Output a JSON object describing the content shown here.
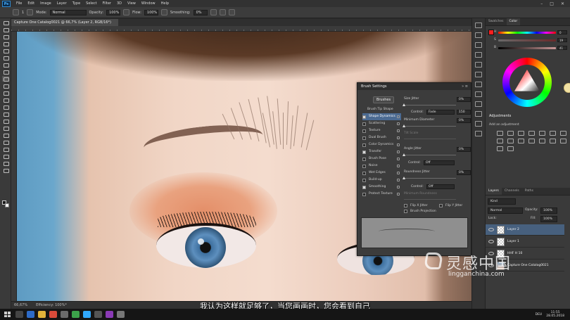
{
  "menu": {
    "logo": "Ps",
    "items": [
      "File",
      "Edit",
      "Image",
      "Layer",
      "Type",
      "Select",
      "Filter",
      "3D",
      "View",
      "Window",
      "Help"
    ]
  },
  "options": {
    "mode_label": "Mode:",
    "mode_value": "Normal",
    "opacity_label": "Opacity:",
    "opacity_value": "100%",
    "flow_label": "Flow:",
    "flow_value": "100%",
    "smoothing_label": "Smoothing:",
    "smoothing_value": "0%",
    "brush_size": "1"
  },
  "document": {
    "tab_title": "Capture One Catalog0021 @ 66,7% (Layer 2, RGB/16*)",
    "status_zoom": "66,67%",
    "status_info": "Efficiency: 100%*"
  },
  "color_panel": {
    "tabs": [
      "Swatches",
      "Color"
    ],
    "active_tab": "Color",
    "rows": [
      {
        "label": "H",
        "value": "0"
      },
      {
        "label": "S",
        "value": "19"
      },
      {
        "label": "B",
        "value": "41"
      }
    ]
  },
  "adjustments": {
    "title": "Adjustments",
    "subtitle": "Add an adjustment"
  },
  "layers": {
    "tabs": [
      "Layers",
      "Channels",
      "Paths"
    ],
    "filter_kind": "Kind",
    "blend_mode": "Normal",
    "opacity_label": "Opacity:",
    "opacity_value": "100%",
    "lock_label": "Lock:",
    "fill_label": "Fill:",
    "fill_value": "100%",
    "items": [
      {
        "name": "Layer 2",
        "selected": true
      },
      {
        "name": "Layer 1",
        "selected": false
      },
      {
        "name": "HHF H 10",
        "selected": false
      },
      {
        "name": "Capture One Catalog0021",
        "selected": false
      }
    ]
  },
  "brush_settings": {
    "title": "Brush Settings",
    "brushes_button": "Brushes",
    "tip_shape": "Brush Tip Shape",
    "items": [
      {
        "label": "Shape Dynamics",
        "checked": true,
        "selected": true
      },
      {
        "label": "Scattering",
        "checked": false
      },
      {
        "label": "Texture",
        "checked": false
      },
      {
        "label": "Dual Brush",
        "checked": false
      },
      {
        "label": "Color Dynamics",
        "checked": false
      },
      {
        "label": "Transfer",
        "checked": true
      },
      {
        "label": "Brush Pose",
        "checked": false
      },
      {
        "label": "Noise",
        "checked": false
      },
      {
        "label": "Wet Edges",
        "checked": false
      },
      {
        "label": "Build-up",
        "checked": false
      },
      {
        "label": "Smoothing",
        "checked": true
      },
      {
        "label": "Protect Texture",
        "checked": false
      }
    ],
    "size_jitter_label": "Size Jitter",
    "size_jitter_value": "0%",
    "control_label": "Control:",
    "control1_value": "Fade",
    "control1_number": "150",
    "min_diameter_label": "Minimum Diameter",
    "min_diameter_value": "0%",
    "tilt_scale_label": "Tilt Scale",
    "angle_jitter_label": "Angle Jitter",
    "angle_jitter_value": "0%",
    "control2_value": "Off",
    "roundness_jitter_label": "Roundness Jitter",
    "roundness_jitter_value": "0%",
    "control3_value": "Off",
    "min_roundness_label": "Minimum Roundness",
    "flip_x_label": "Flip X Jitter",
    "flip_y_label": "Flip Y Jitter",
    "brush_projection_label": "Brush Projection"
  },
  "subtitle": "我认为这样就足够了，当您画画时，您会看到自己",
  "watermark": {
    "text": "灵感中国",
    "url": "lingganchina.com"
  },
  "taskbar": {
    "lang": "DEU",
    "time": "11:55",
    "date": "28.05.2018"
  }
}
